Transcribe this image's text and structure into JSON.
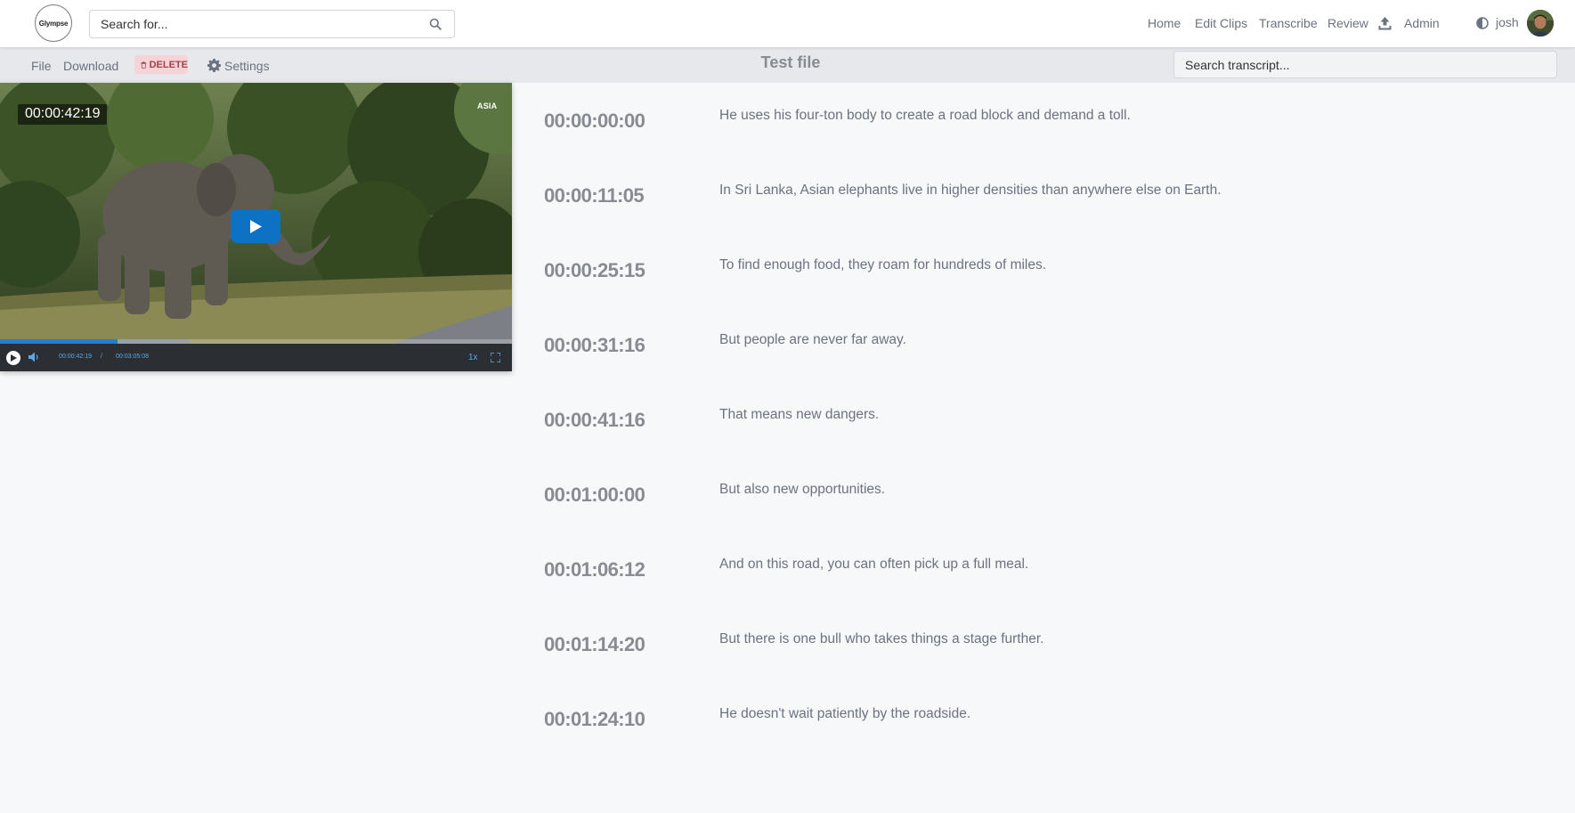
{
  "app": {
    "logo_text": "Glympse"
  },
  "search": {
    "placeholder": "Search for..."
  },
  "nav": {
    "links": [
      {
        "label": "Home"
      },
      {
        "label": "Edit Clips"
      },
      {
        "label": "Transcribe"
      },
      {
        "label": "Review"
      },
      {
        "label": "Admin"
      }
    ],
    "upload_icon": "upload-icon",
    "theme_icon": "contrast-icon",
    "user": {
      "name": "josh"
    }
  },
  "toolbar": {
    "file_label": "File",
    "download_label": "Download",
    "delete_label": "DELETE",
    "settings_label": "Settings",
    "title": "Test file",
    "transcript_search_placeholder": "Search transcript..."
  },
  "player": {
    "timecode_overlay": "00:00:42:19",
    "watermark": "ASIA",
    "current_time": "00:00:42:19",
    "time_separator": "/",
    "duration": "00:03:05:08",
    "rate": "1x",
    "progress_fraction": 0.23,
    "buffered_fraction": 0.37,
    "accent_color": "#0e72c4"
  },
  "transcript": {
    "segments": [
      {
        "time": "00:00:00:00",
        "text": "He uses his four-ton body to create a road block and demand a toll."
      },
      {
        "time": "00:00:11:05",
        "text": "In Sri Lanka, Asian elephants live in higher densities than anywhere else on Earth."
      },
      {
        "time": "00:00:25:15",
        "text": "To find enough food, they roam for hundreds of miles."
      },
      {
        "time": "00:00:31:16",
        "text": "But people are never far away."
      },
      {
        "time": "00:00:41:16",
        "text": "That means new dangers."
      },
      {
        "time": "00:01:00:00",
        "text": "But also new opportunities."
      },
      {
        "time": "00:01:06:12",
        "text": "And on this road, you can often pick up a full meal."
      },
      {
        "time": "00:01:14:20",
        "text": "But there is one bull who takes things a stage further."
      },
      {
        "time": "00:01:24:10",
        "text": "He doesn't wait patiently by the roadside."
      }
    ]
  }
}
